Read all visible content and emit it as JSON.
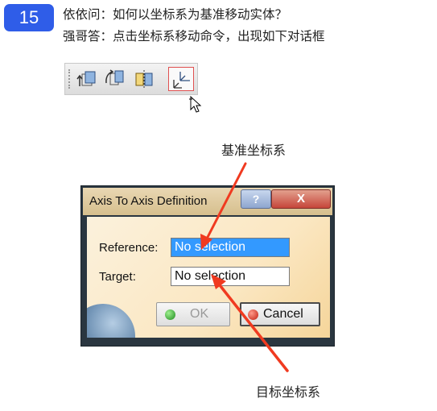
{
  "badge": "15",
  "question": "依依问：如何以坐标系为基准移动实体？",
  "answer": "强哥答：点击坐标系移动命令，出现如下对话框",
  "annotations": {
    "reference_label": "基准坐标系",
    "target_label": "目标坐标系",
    "arrow_color": "#f03a20"
  },
  "toolbar": {
    "icons": [
      "translate-icon",
      "rotate-icon",
      "symmetry-icon",
      "axis-to-axis-icon"
    ],
    "active_icon": "axis-to-axis-icon"
  },
  "dialog": {
    "title": "Axis To Axis Definition",
    "help_label": "?",
    "close_label": "X",
    "reference_label": "Reference:",
    "reference_value": "No selection",
    "target_label": "Target:",
    "target_value": "No selection",
    "ok_label": "OK",
    "cancel_label": "Cancel"
  }
}
